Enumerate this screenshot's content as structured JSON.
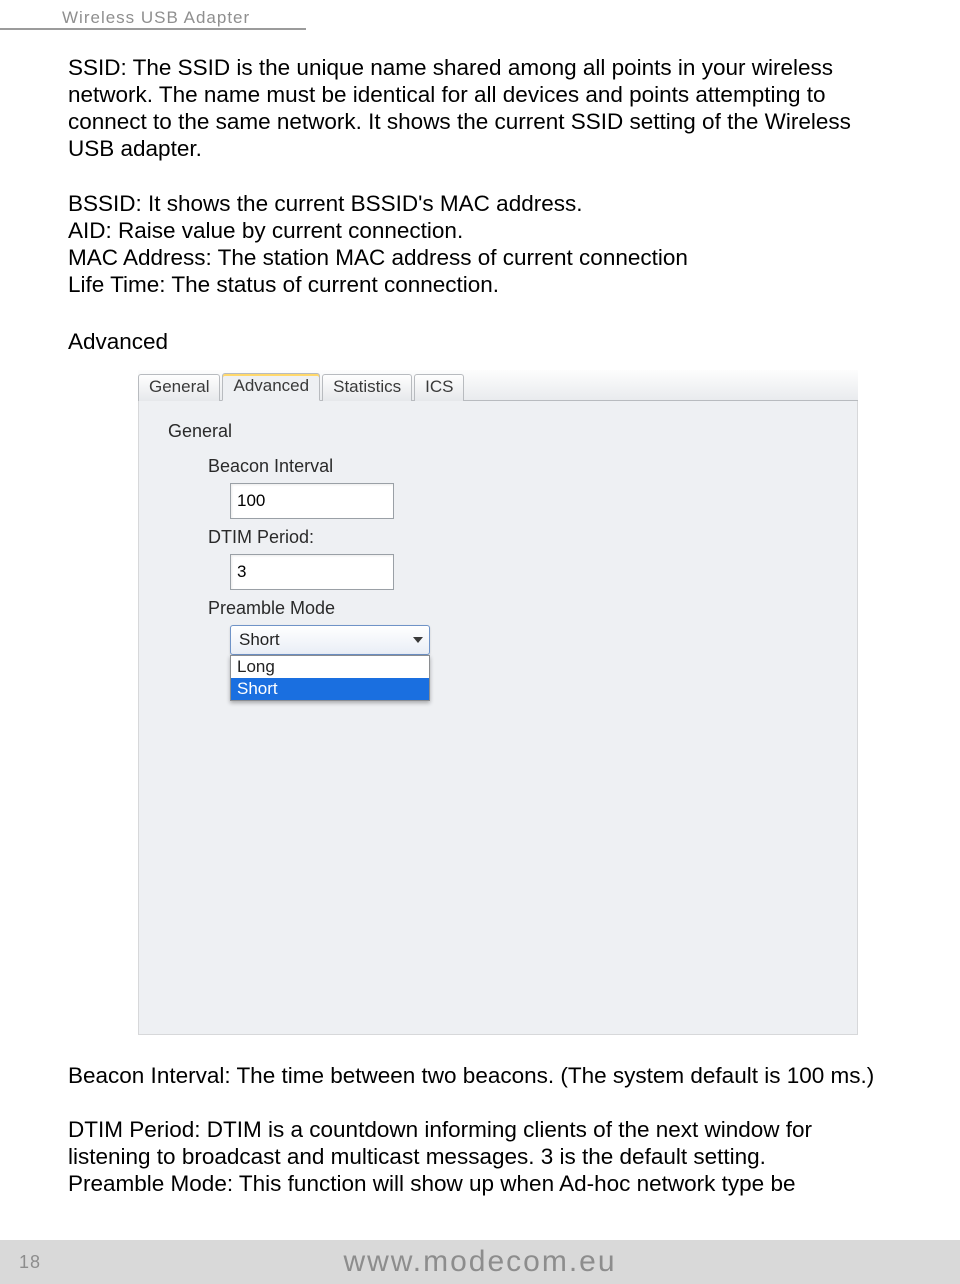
{
  "header": {
    "title": "Wireless USB Adapter"
  },
  "paragraphs": {
    "ssid": "SSID: The SSID is the unique name shared among all points in your wireless network. The name must be identical for all devices and points attempting to connect to the same network. It shows the current SSID setting of the Wireless USB adapter.",
    "bssid": "BSSID: It shows the current BSSID's MAC address.",
    "aid": "AID: Raise value by current connection.",
    "mac": "MAC Address: The station MAC address of current connection",
    "life": "Life Time: The status of current connection.",
    "advanced_heading": "Advanced",
    "beacon": "Beacon Interval: The time between two beacons. (The system default is 100 ms.)",
    "dtim": "DTIM Period: DTIM is a countdown informing clients of the next window for listening to broadcast and multicast messages. 3 is the default setting.",
    "preamble": "Preamble Mode: This function will show up when Ad-hoc network type be"
  },
  "panel": {
    "tabs": {
      "general": "General",
      "advanced": "Advanced",
      "statistics": "Statistics",
      "ics": "ICS"
    },
    "group_title": "General",
    "beacon_label": "Beacon Interval",
    "beacon_value": "100",
    "dtim_label": "DTIM Period:",
    "dtim_value": "3",
    "preamble_label": "Preamble Mode",
    "preamble_selected": "Short",
    "preamble_options": {
      "long": "Long",
      "short": "Short"
    }
  },
  "footer": {
    "page_number": "18",
    "url": "www.modecom.eu"
  }
}
